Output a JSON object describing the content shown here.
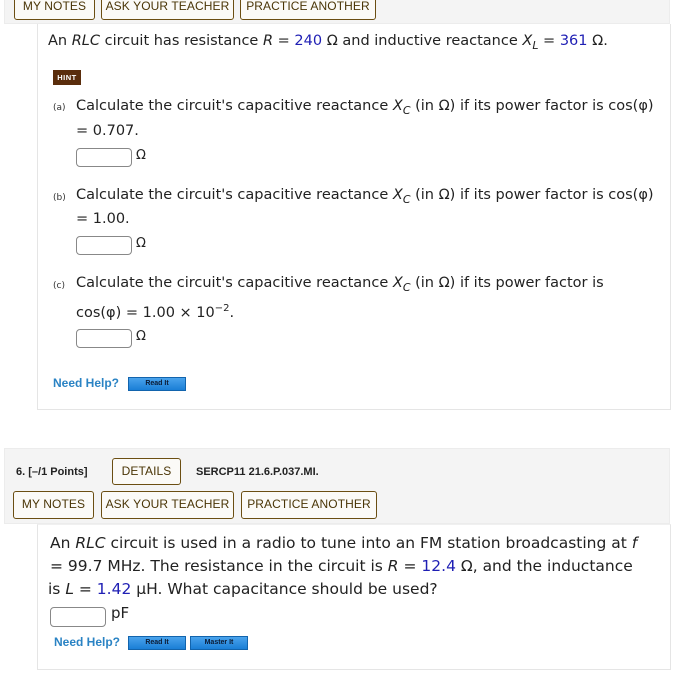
{
  "q5": {
    "toolbar": {
      "my_notes": "MY NOTES",
      "ask_teacher": "ASK YOUR TEACHER",
      "practice_another": "PRACTICE ANOTHER"
    },
    "statement": {
      "p1": "An ",
      "rlc": "RLC",
      "p2": " circuit has resistance ",
      "R": "R",
      "p3": " = ",
      "R_value": "240",
      "p4": " Ω and inductive reactance ",
      "X": "X",
      "X_sub": "L",
      "p5": " = ",
      "XL_value": "361",
      "p6": " Ω."
    },
    "hint_label": "HINT",
    "parts": [
      {
        "label": "(a)",
        "line1": "Calculate the circuit's capacitive reactance ",
        "var": "X",
        "var_sub": "C",
        "line1b": " (in Ω) if its power factor is cos(φ)",
        "line2": "= 0.707.",
        "answer": "",
        "unit": "Ω"
      },
      {
        "label": "(b)",
        "line1": "Calculate the circuit's capacitive reactance ",
        "var": "X",
        "var_sub": "C",
        "line1b": " (in Ω) if its power factor is cos(φ)",
        "line2": "= 1.00.",
        "answer": "",
        "unit": "Ω"
      },
      {
        "label": "(c)",
        "line1": "Calculate the circuit's capacitive reactance ",
        "var": "X",
        "var_sub": "C",
        "line1b": " (in Ω) if its power factor is",
        "line2": "cos(φ) = 1.00 × 10",
        "line2_sup": "−2",
        "line2_end": ".",
        "answer": "",
        "unit": "Ω"
      }
    ],
    "need_help": "Need Help?",
    "read_it": "Read It"
  },
  "q6": {
    "points": "6.  [–/1 Points]",
    "details": "DETAILS",
    "code": "SERCP11 21.6.P.037.MI.",
    "toolbar": {
      "my_notes": "MY NOTES",
      "ask_teacher": "ASK YOUR TEACHER",
      "practice_another": "PRACTICE ANOTHER"
    },
    "statement": {
      "l1a": "An ",
      "rlc": "RLC",
      "l1b": " circuit is used in a radio to tune into an FM station broadcasting at ",
      "f": "f",
      "l2a": "= 99.7 MHz. The resistance in the circuit is ",
      "R": "R",
      "l2b": " = ",
      "R_value": "12.4",
      "l2c": " Ω, and the inductance",
      "l3a": "is ",
      "L": "L",
      "l3b": " = ",
      "L_value": "1.42",
      "l3c": " μH. What capacitance should be used?"
    },
    "answer": "",
    "unit": "pF",
    "need_help": "Need Help?",
    "read_it": "Read It",
    "master_it": "Master It"
  }
}
